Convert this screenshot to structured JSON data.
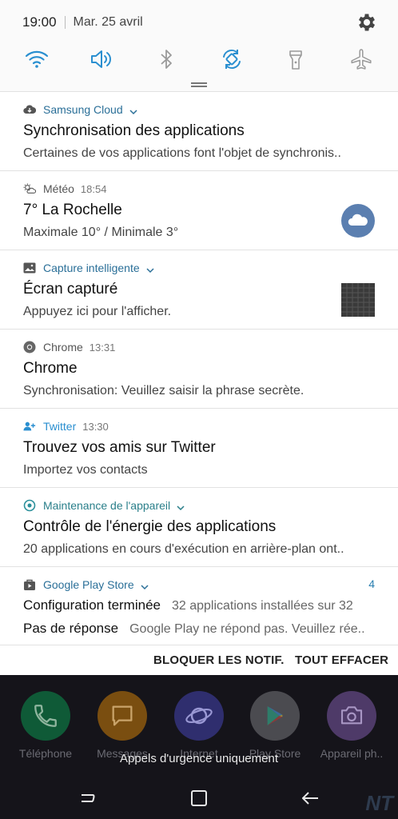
{
  "status_bar": {
    "time": "19:00",
    "date": "Mar. 25 avril"
  },
  "quick_settings": [
    {
      "icon": "wifi-icon",
      "active": true
    },
    {
      "icon": "sound-icon",
      "active": true
    },
    {
      "icon": "bluetooth-icon",
      "active": false
    },
    {
      "icon": "auto-rotate-icon",
      "active": true
    },
    {
      "icon": "flashlight-icon",
      "active": false
    },
    {
      "icon": "airplane-mode-icon",
      "active": false
    }
  ],
  "colors": {
    "accent": "#2a8fd0",
    "app_name_blue": "#2a6f98",
    "inactive_icon": "#9a9a9a",
    "home_bg": "#15141a"
  },
  "notifications": [
    {
      "app": "Samsung Cloud",
      "time": "",
      "title": "Synchronisation des applications",
      "text": "Certaines de vos applications font l'objet de synchronis.."
    },
    {
      "app": "Météo",
      "time": "18:54",
      "title": "7° La Rochelle",
      "text": "Maximale 10° / Minimale 3°"
    },
    {
      "app": "Capture intelligente",
      "time": "",
      "title": "Écran capturé",
      "text": "Appuyez ici pour l'afficher."
    },
    {
      "app": "Chrome",
      "time": "13:31",
      "title": "Chrome",
      "text": "Synchronisation: Veuillez saisir la phrase secrète."
    },
    {
      "app": "Twitter",
      "time": "13:30",
      "title": "Trouvez vos amis sur Twitter",
      "text": "Importez vos contacts"
    },
    {
      "app": "Maintenance de l'appareil",
      "time": "",
      "title": "Contrôle de l'énergie des applications",
      "text": "20 applications en cours d'exécution en arrière-plan ont.."
    }
  ],
  "play_store": {
    "app": "Google Play Store",
    "count": "4",
    "rows": [
      {
        "key": "Configuration terminée",
        "value": "32 applications installées sur 32"
      },
      {
        "key": "Pas de réponse",
        "value": "Google Play ne répond pas. Veuillez rée.."
      }
    ]
  },
  "actions": {
    "block": "BLOQUER LES NOTIF.",
    "clear": "TOUT EFFACER"
  },
  "home": {
    "apps": [
      "Téléphone",
      "Messages",
      "Internet",
      "Play Store",
      "Appareil ph.."
    ],
    "emergency": "Appels d'urgence uniquement"
  },
  "watermark": "NT"
}
